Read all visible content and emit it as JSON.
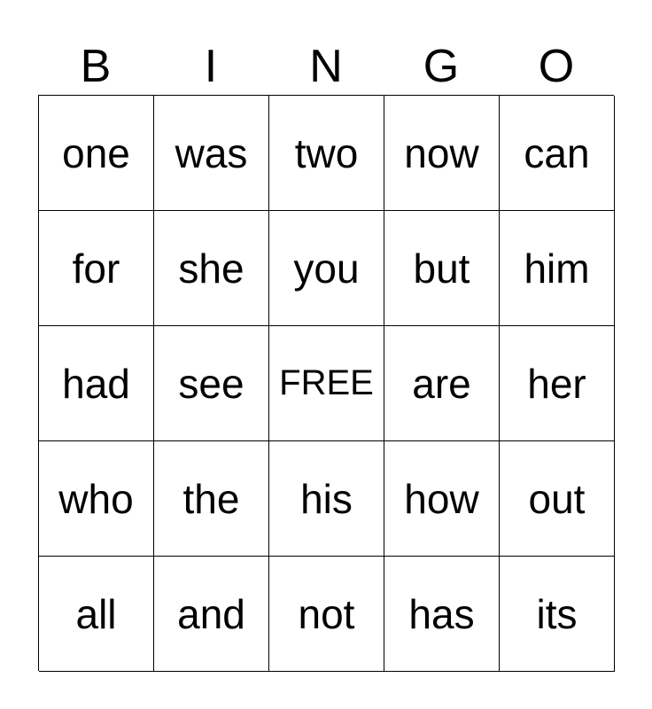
{
  "header": [
    "B",
    "I",
    "N",
    "G",
    "O"
  ],
  "rows": [
    [
      "one",
      "was",
      "two",
      "now",
      "can"
    ],
    [
      "for",
      "she",
      "you",
      "but",
      "him"
    ],
    [
      "had",
      "see",
      "FREE",
      "are",
      "her"
    ],
    [
      "who",
      "the",
      "his",
      "how",
      "out"
    ],
    [
      "all",
      "and",
      "not",
      "has",
      "its"
    ]
  ]
}
